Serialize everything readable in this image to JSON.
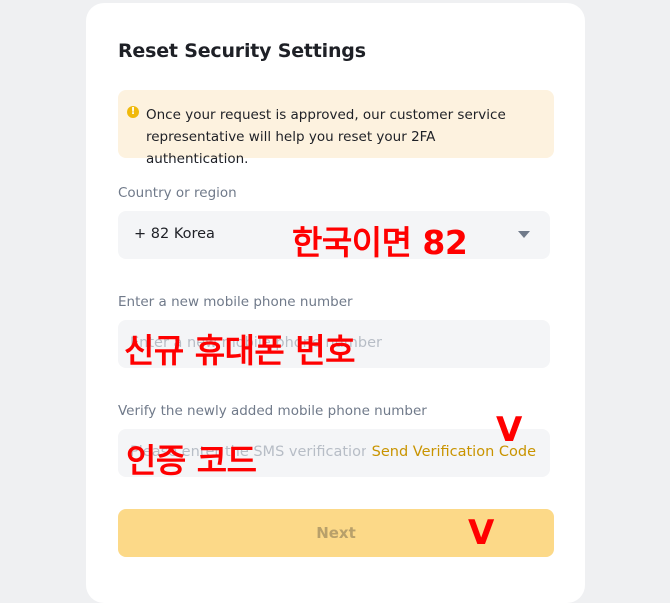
{
  "dialog": {
    "title": "Reset Security Settings",
    "notice": {
      "icon": "warning-icon",
      "icon_glyph": "!",
      "text": "Once your request is approved, our customer service representative will help you reset your 2FA authentication."
    },
    "country": {
      "label": "Country or region",
      "value": "+ 82 Korea",
      "dropdown_icon": "caret-down-icon"
    },
    "phone": {
      "label": "Enter a new mobile phone number",
      "placeholder": "Enter a new mobile phone number"
    },
    "verify": {
      "label": "Verify the newly added mobile phone number",
      "placeholder": "Please enter the SMS verification code",
      "send_button": "Send Verification Code"
    },
    "next_button": "Next"
  },
  "annotations": {
    "country_note": "한국이면 82",
    "phone_note": "신규 휴대폰 번호",
    "code_note": "인증 코드",
    "send_check": "V",
    "next_check": "V"
  },
  "colors": {
    "accent": "#f0b90b",
    "link": "#c99400",
    "button_disabled": "#fcd988",
    "annotation": "#ff0000"
  }
}
